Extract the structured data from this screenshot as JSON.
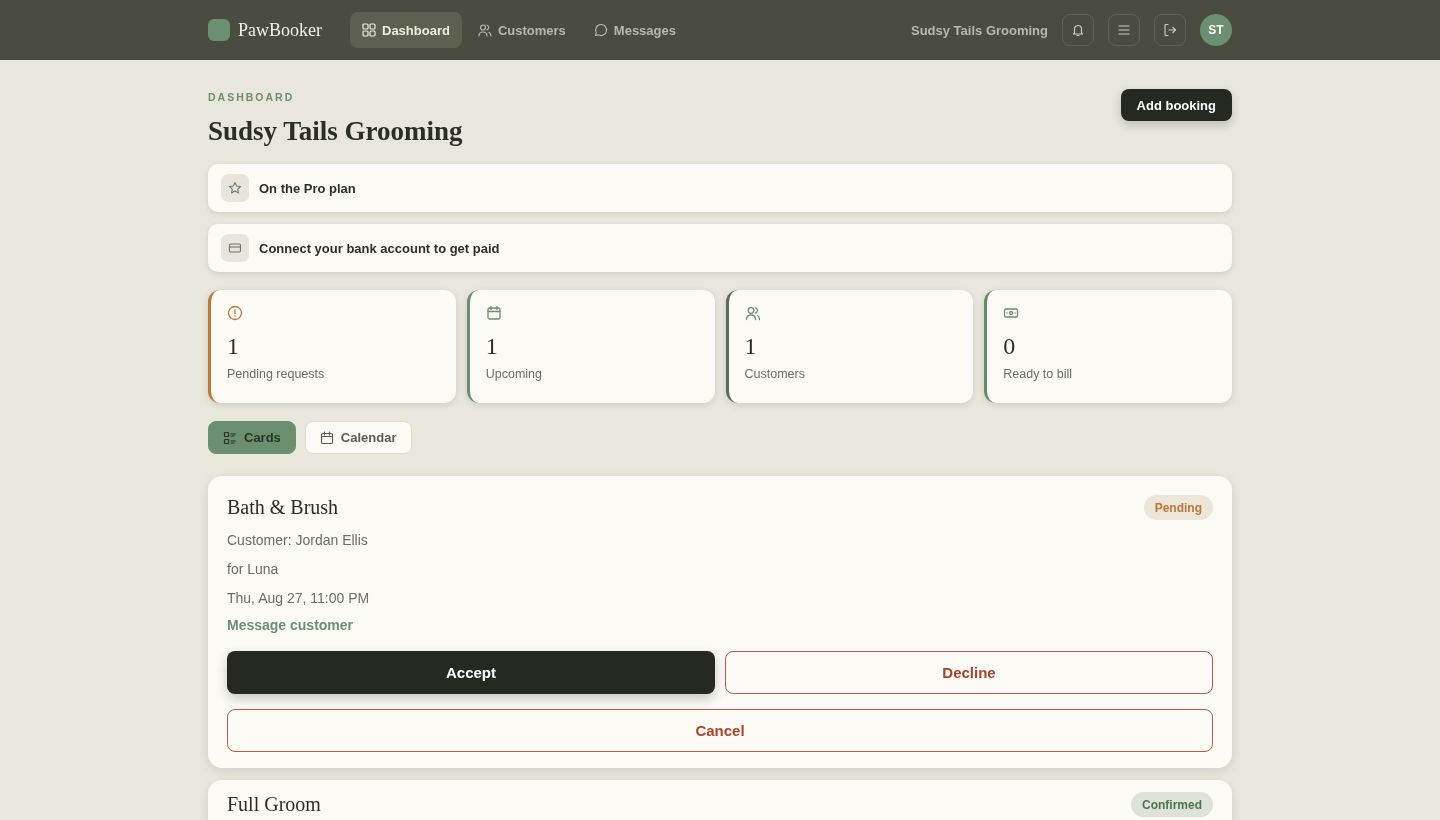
{
  "header": {
    "logo": "PawBooker",
    "nav": [
      {
        "label": "Dashboard",
        "selected": true
      },
      {
        "label": "Customers",
        "selected": false
      },
      {
        "label": "Messages",
        "selected": false
      }
    ],
    "business_name": "Sudsy Tails Grooming",
    "avatar": "ST"
  },
  "page": {
    "eyebrow": "DASHBOARD",
    "title": "Sudsy Tails Grooming",
    "add_button": "Add booking"
  },
  "banners": [
    {
      "text": "On the Pro plan"
    },
    {
      "text": "Connect your bank account to get paid"
    }
  ],
  "stats": [
    {
      "value": "1",
      "label": "Pending requests",
      "color": "#b8793a"
    },
    {
      "value": "1",
      "label": "Upcoming",
      "color": "#6b8f71"
    },
    {
      "value": "1",
      "label": "Customers",
      "color": "#5e6b5a"
    },
    {
      "value": "0",
      "label": "Ready to bill",
      "color": "#5f8c67"
    }
  ],
  "view_tabs": [
    {
      "label": "Cards",
      "selected": true
    },
    {
      "label": "Calendar",
      "selected": false
    }
  ],
  "bookings": [
    {
      "service": "Bath & Brush",
      "status": {
        "label": "Pending",
        "kind": "pending"
      },
      "customer": "Customer: Jordan Ellis",
      "pet": "for Luna",
      "time": "Thu, Aug 27, 11:00 PM",
      "link": "Message customer",
      "actions": [
        {
          "label": "Accept",
          "kind": "primary"
        },
        {
          "label": "Decline",
          "kind": "danger"
        },
        {
          "label": "Cancel",
          "kind": "danger"
        }
      ]
    },
    {
      "service": "Full Groom",
      "status": {
        "label": "Confirmed",
        "kind": "confirmed"
      }
    }
  ]
}
